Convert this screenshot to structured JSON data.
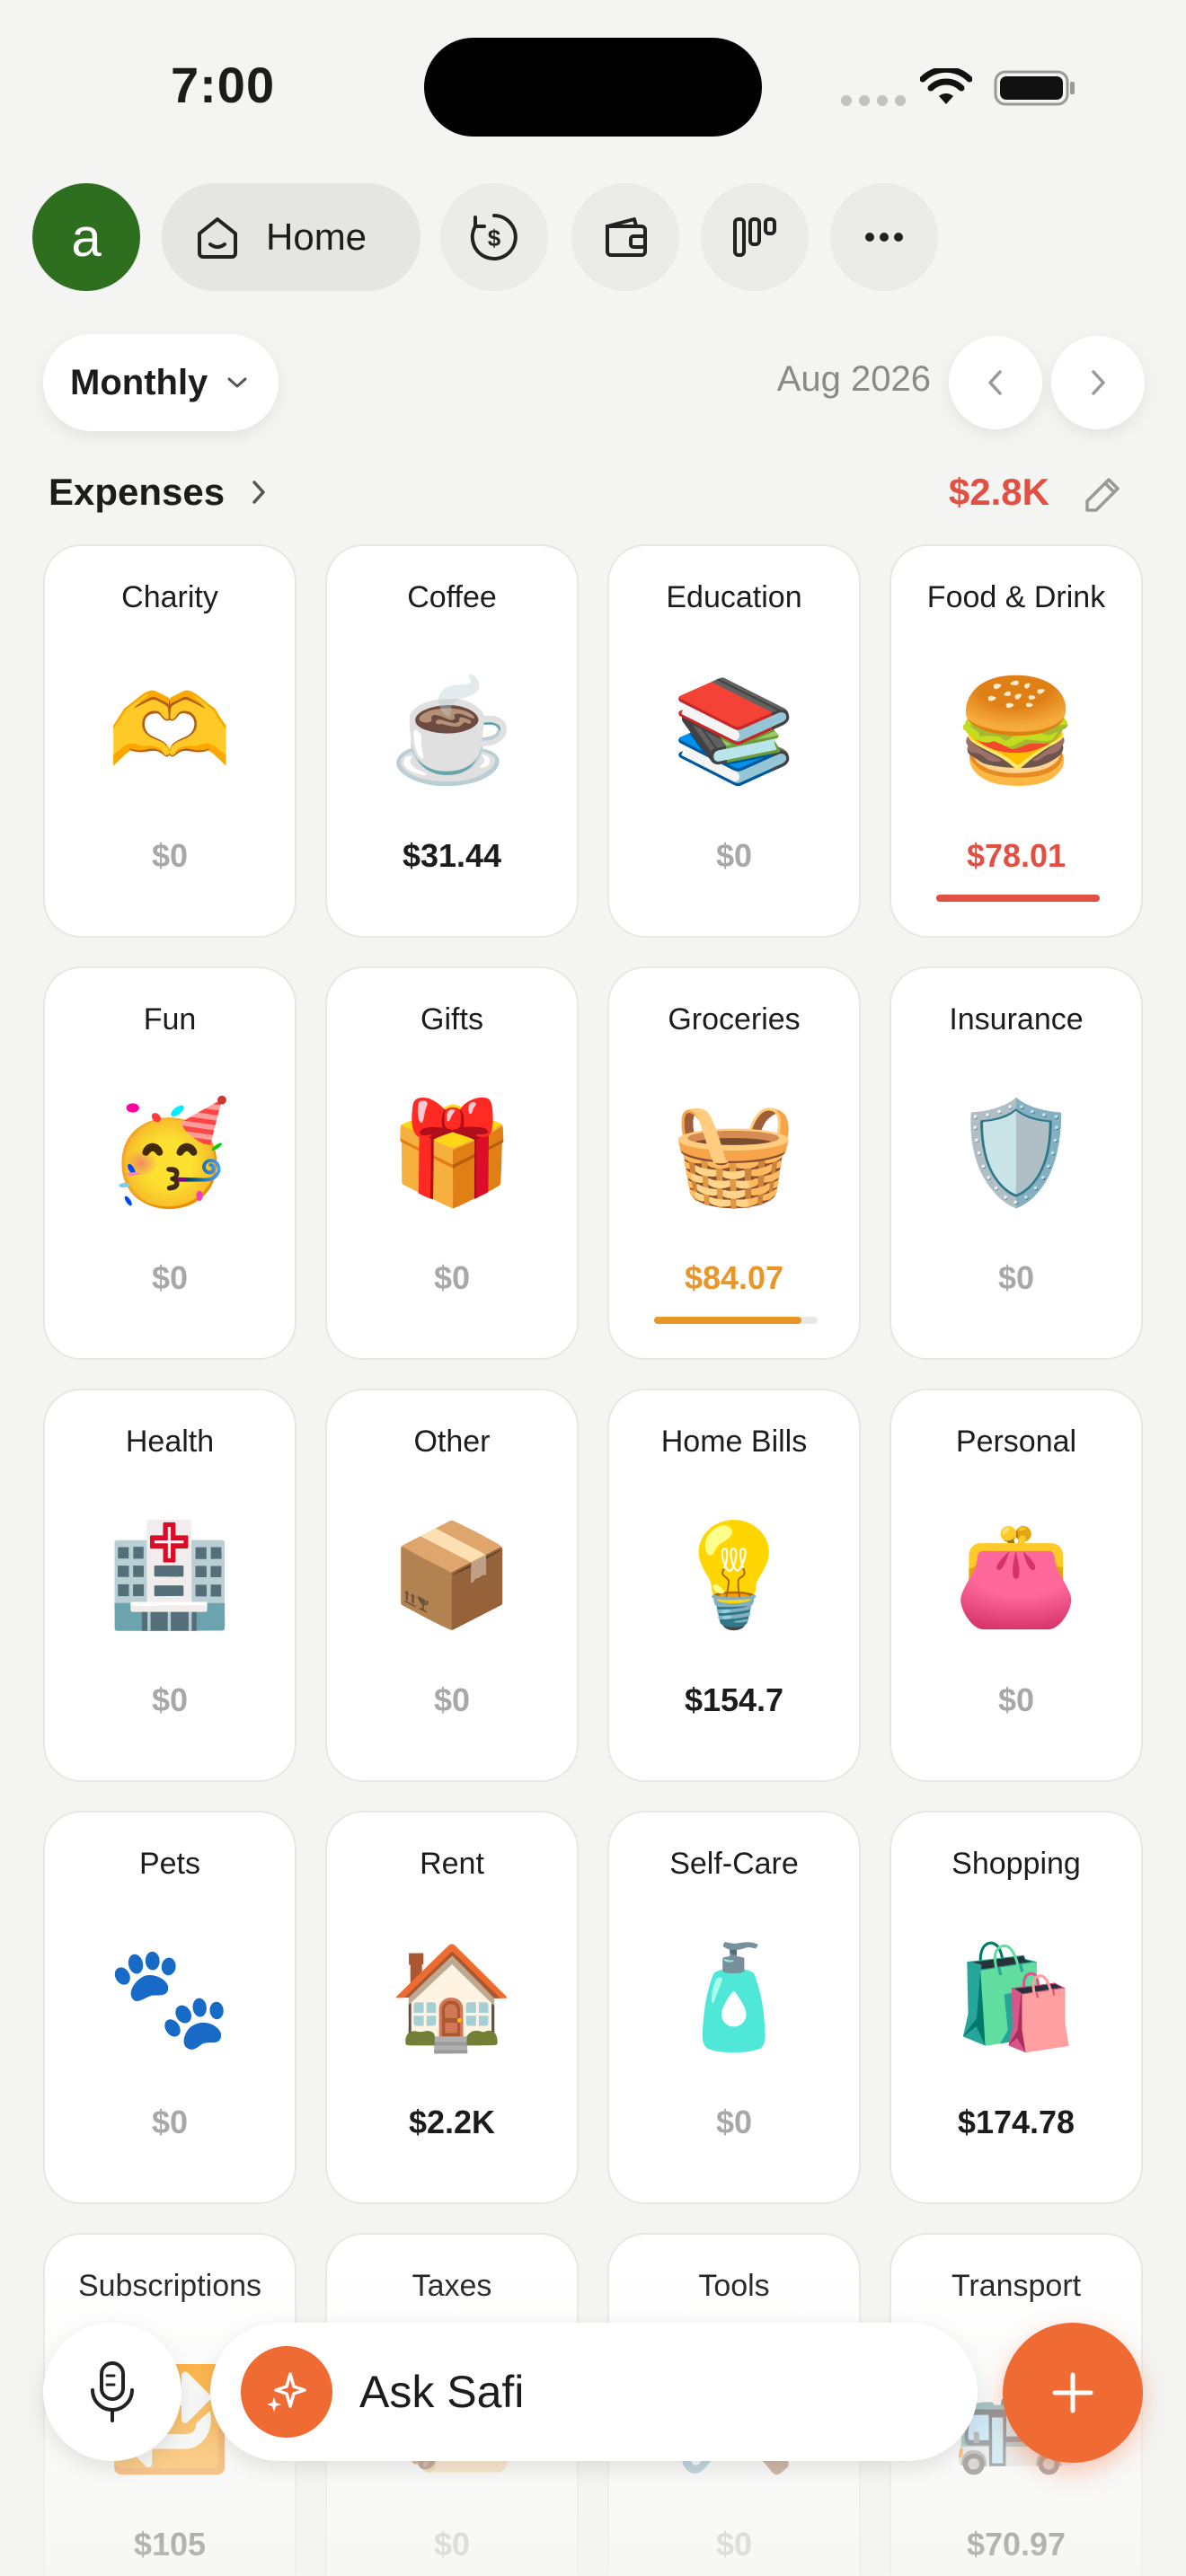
{
  "status_bar": {
    "time": "7:00"
  },
  "nav": {
    "avatar_letter": "a",
    "avatar_color": "#2e6e1f",
    "home_label": "Home",
    "icons": [
      "dollar-circle-icon",
      "wallet-icon",
      "chart-icon",
      "more-icon"
    ]
  },
  "period": {
    "selector_label": "Monthly",
    "date_label": "Aug 2026"
  },
  "expenses": {
    "title": "Expenses",
    "total": "$2.8K",
    "total_color": "#e24f43"
  },
  "categories": [
    {
      "name": "Charity",
      "icon": "heart-hands-icon",
      "emoji": "🫶",
      "amount": "$0",
      "state": "zero"
    },
    {
      "name": "Coffee",
      "icon": "coffee-cup-icon",
      "emoji": "☕",
      "amount": "$31.44",
      "state": "normal"
    },
    {
      "name": "Education",
      "icon": "books-icon",
      "emoji": "📚",
      "amount": "$0",
      "state": "zero"
    },
    {
      "name": "Food & Drink",
      "icon": "burger-drink-icon",
      "emoji": "🍔",
      "amount": "$78.01",
      "state": "over",
      "progress": 1.0,
      "bar_color": "#e24f43"
    },
    {
      "name": "Fun",
      "icon": "party-hat-icon",
      "emoji": "🥳",
      "amount": "$0",
      "state": "zero"
    },
    {
      "name": "Gifts",
      "icon": "gift-icon",
      "emoji": "🎁",
      "amount": "$0",
      "state": "zero"
    },
    {
      "name": "Groceries",
      "icon": "grocery-basket-icon",
      "emoji": "🧺",
      "amount": "$84.07",
      "state": "warn",
      "progress": 0.9,
      "bar_color": "#e8962a"
    },
    {
      "name": "Insurance",
      "icon": "shield-check-icon",
      "emoji": "🛡️",
      "amount": "$0",
      "state": "zero"
    },
    {
      "name": "Health",
      "icon": "hospital-icon",
      "emoji": "🏥",
      "amount": "$0",
      "state": "zero"
    },
    {
      "name": "Other",
      "icon": "box-icon",
      "emoji": "📦",
      "amount": "$0",
      "state": "zero"
    },
    {
      "name": "Home Bills",
      "icon": "lightbulb-icon",
      "emoji": "💡",
      "amount": "$154.7",
      "state": "normal"
    },
    {
      "name": "Personal",
      "icon": "wallet-icon",
      "emoji": "👛",
      "amount": "$0",
      "state": "zero"
    },
    {
      "name": "Pets",
      "icon": "paw-icon",
      "emoji": "🐾",
      "amount": "$0",
      "state": "zero"
    },
    {
      "name": "Rent",
      "icon": "house-icon",
      "emoji": "🏠",
      "amount": "$2.2K",
      "state": "normal"
    },
    {
      "name": "Self-Care",
      "icon": "lotion-icon",
      "emoji": "🧴",
      "amount": "$0",
      "state": "zero"
    },
    {
      "name": "Shopping",
      "icon": "shopping-bag-icon",
      "emoji": "🛍️",
      "amount": "$174.78",
      "state": "normal"
    },
    {
      "name": "Subscriptions",
      "icon": "refresh-icon",
      "emoji": "🔁",
      "amount": "$105",
      "state": "normal"
    },
    {
      "name": "Taxes",
      "icon": "scroll-icon",
      "emoji": "📜",
      "amount": "$0",
      "state": "zero"
    },
    {
      "name": "Tools",
      "icon": "tools-icon",
      "emoji": "🛠️",
      "amount": "$0",
      "state": "zero"
    },
    {
      "name": "Transport",
      "icon": "bus-icon",
      "emoji": "🚌",
      "amount": "$70.97",
      "state": "normal"
    }
  ],
  "bottom_bar": {
    "ask_label": "Ask Safi",
    "accent_color": "#f06a33"
  }
}
